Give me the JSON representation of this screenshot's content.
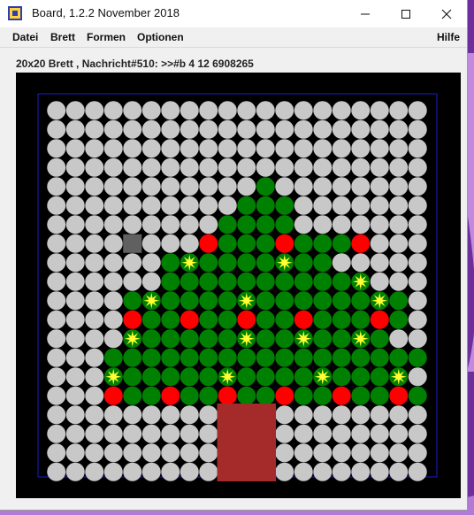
{
  "window": {
    "title": "Board, 1.2.2 November 2018",
    "controls": [
      "minimize",
      "maximize",
      "close"
    ]
  },
  "menu": {
    "items": [
      "Datei",
      "Brett",
      "Formen",
      "Optionen"
    ],
    "help": "Hilfe"
  },
  "status_text": "20x20 Brett , Nachricht#510: >>#b 4 12 6908265",
  "board": {
    "rows": 20,
    "cols": 20,
    "colors": {
      "background": "#000000",
      "frame": "#1c1ccc",
      "empty": "#c8c8c8",
      "tree": "#008000",
      "ornament": "#ff0000",
      "star": "#ffff33",
      "trunk": "#a52a2a",
      "marker": "#606060"
    },
    "cells": [
      "....................",
      "....................",
      "....................",
      "....................",
      "...........g........",
      "..........ggg.......",
      ".........gggg.......",
      "....X...RgggRgggR...",
      "......g*gggg*gg.....",
      "......gggggggggg*...",
      "....g*gggg*gggggg*g.",
      "....RggRggRggRgggRg.",
      "....*ggggg*gg*gg*g..",
      "...ggggggggggggggggg",
      "...*ggggg*gggg*ggg*.",
      "...RggRggRggRggRggRg",
      "....................",
      "....................",
      "....................",
      "...................."
    ],
    "trunk": {
      "col_start": 9,
      "col_end": 12,
      "row_start": 16,
      "row_end": 19
    }
  }
}
